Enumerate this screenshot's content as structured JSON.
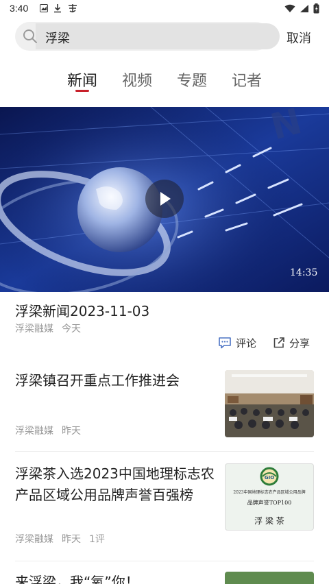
{
  "status_bar": {
    "time": "3:40"
  },
  "search": {
    "query": "浮梁",
    "cancel_label": "取消"
  },
  "tabs": [
    {
      "label": "新闻"
    },
    {
      "label": "视频"
    },
    {
      "label": "专题"
    },
    {
      "label": "记者"
    }
  ],
  "hero": {
    "duration": "14:35",
    "title": "浮梁新闻2023-11-03",
    "source": "浮梁融媒",
    "time": "今天",
    "comment_label": "评论",
    "share_label": "分享"
  },
  "news": [
    {
      "title": "浮梁镇召开重点工作推进会",
      "source": "浮梁融媒",
      "time": "昨天",
      "comments": ""
    },
    {
      "title": "浮梁茶入选2023中国地理标志农产品区域公用品牌声誉百强榜",
      "source": "浮梁融媒",
      "time": "昨天",
      "comments": "1评",
      "thumb_text": {
        "line1": "2023中国地理标志农产品区域公用品牌",
        "line2": "品牌声誉TOP100",
        "line3": "浮 梁 茶"
      }
    },
    {
      "title": "来浮梁，我“氧”你！",
      "source": "",
      "time": "",
      "comments": ""
    }
  ],
  "colors": {
    "accent": "#c8202a",
    "hero_bg": "#0f1f5c"
  }
}
